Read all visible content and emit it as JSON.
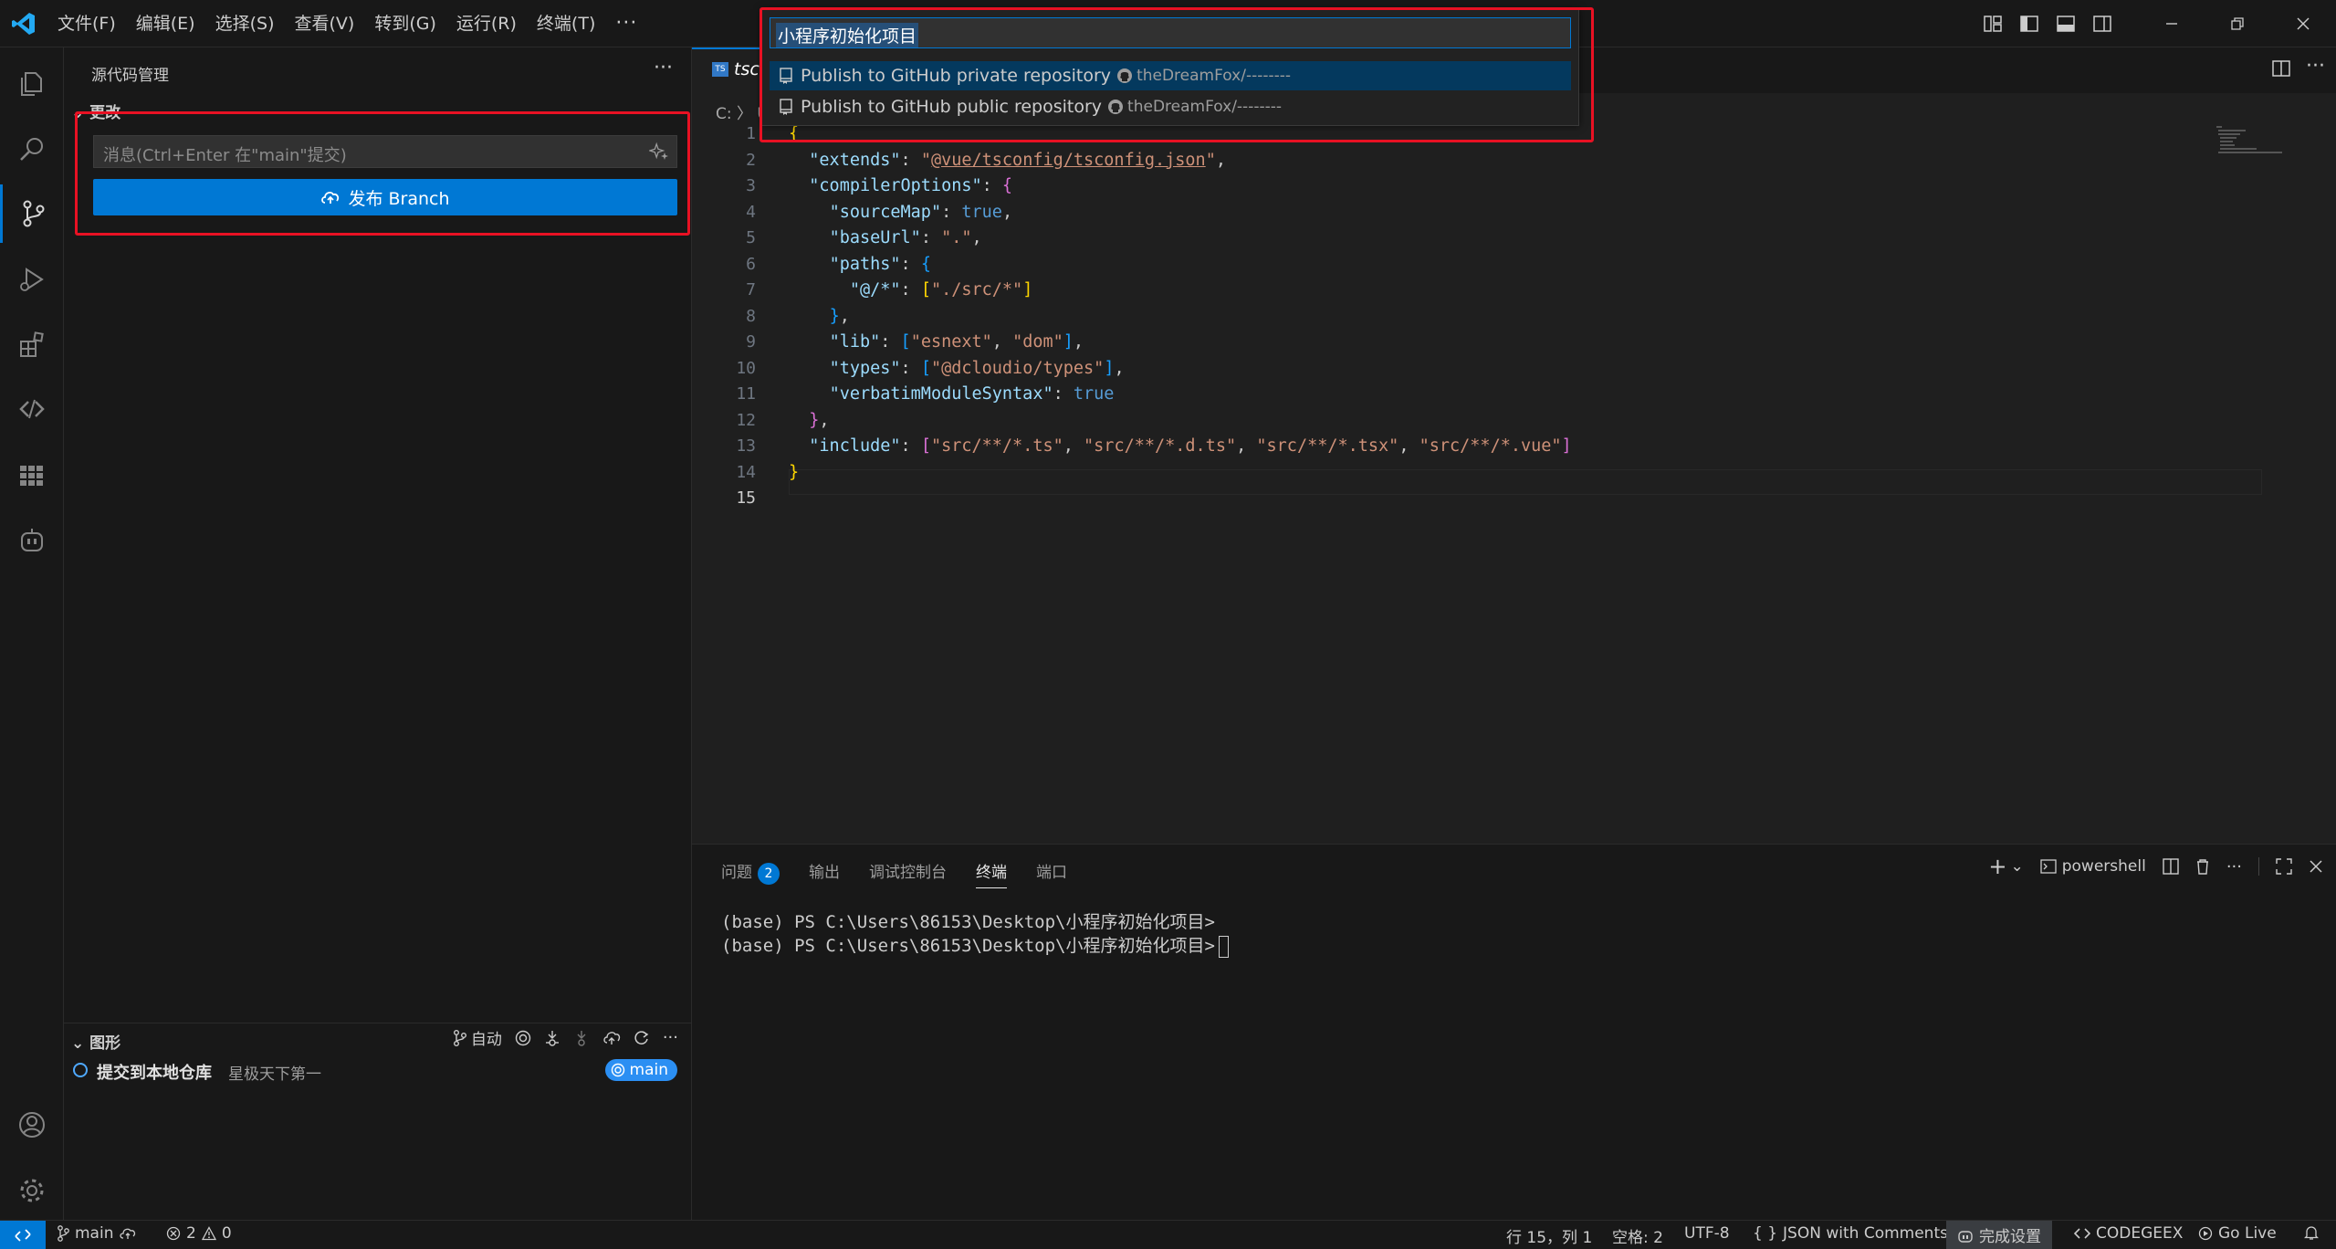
{
  "menu": [
    "文件(F)",
    "编辑(E)",
    "选择(S)",
    "查看(V)",
    "转到(G)",
    "运行(R)",
    "终端(T)"
  ],
  "menu_more": "···",
  "sidebar": {
    "title": "源代码管理",
    "changes_label": "更改",
    "commit_placeholder": "消息(Ctrl+Enter 在\"main\"提交)",
    "publish_label": "发布 Branch",
    "graph_label": "图形",
    "graph_auto": "自动",
    "graph_commit_message": "提交到本地仓库",
    "graph_commit_author": "星极天下第一",
    "graph_branch": "main"
  },
  "quick_pick": {
    "input_value": "小程序初始化项目",
    "items": [
      {
        "label": "Publish to GitHub private repository",
        "desc": "theDreamFox/--------"
      },
      {
        "label": "Publish to GitHub public repository",
        "desc": "theDreamFox/--------"
      }
    ]
  },
  "editor": {
    "tab_name": "tsc",
    "breadcrumb": "C: 〉 U",
    "line_numbers": [
      "1",
      "2",
      "3",
      "4",
      "5",
      "6",
      "7",
      "8",
      "9",
      "10",
      "11",
      "12",
      "13",
      "14",
      "15"
    ]
  },
  "panel": {
    "tabs": [
      "问题",
      "输出",
      "调试控制台",
      "终端",
      "端口"
    ],
    "problems_count": "2",
    "shell": "powershell",
    "terminal_lines": [
      "(base) PS C:\\Users\\86153\\Desktop\\小程序初始化项目>",
      "(base) PS C:\\Users\\86153\\Desktop\\小程序初始化项目>"
    ]
  },
  "statusbar": {
    "branch": "main",
    "errors": "2",
    "warnings": "0",
    "position": "行 15，列 1",
    "spaces": "空格: 2",
    "encoding": "UTF-8",
    "language": "JSON with Comments",
    "language_icon": "{ }",
    "done": "完成设置",
    "codegeex": "CODEGEEX",
    "golive": "Go Live"
  }
}
